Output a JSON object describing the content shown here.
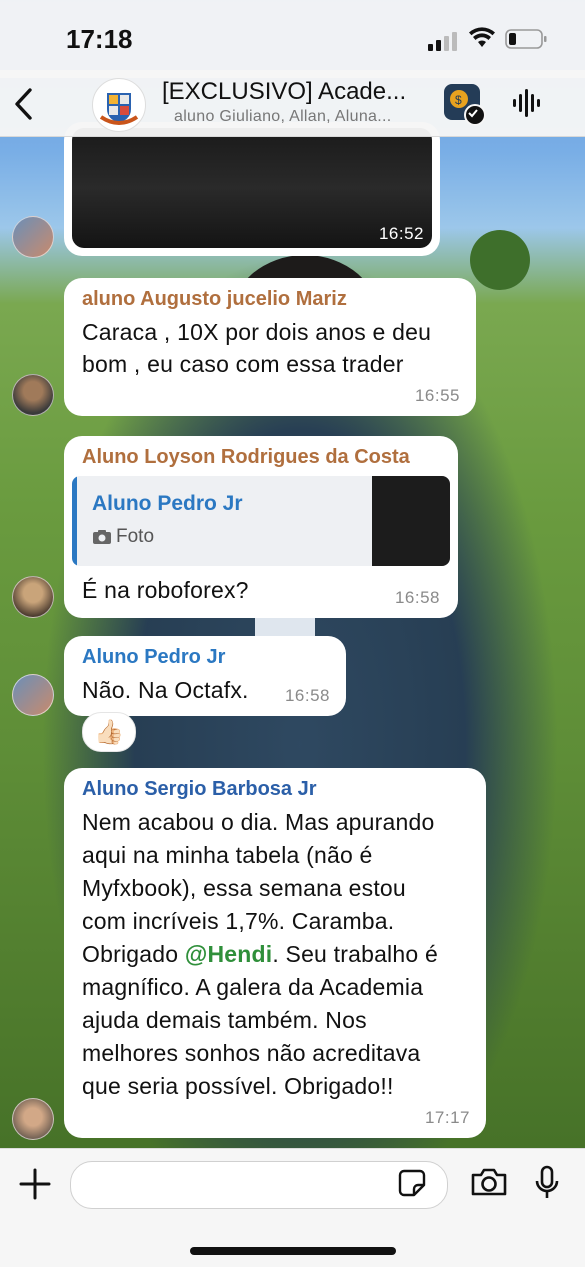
{
  "status_bar": {
    "time": "17:18"
  },
  "header": {
    "title": "[EXCLUSIVO] Acade...",
    "subtitle": "aluno Giuliano, Allan, Aluna...",
    "group_avatar_icon": "academy-crest-icon",
    "app_badge_icon": "copy-trade-icon"
  },
  "messages": [
    {
      "type": "video",
      "timestamp": "16:52"
    },
    {
      "type": "text",
      "sender": "aluno Augusto jucelio Mariz",
      "sender_color": "#b06f3e",
      "text_lines": [
        "Caraca , 10X por dois anos e deu",
        "bom , eu caso com essa trader"
      ],
      "timestamp": "16:55"
    },
    {
      "type": "reply",
      "sender": "Aluno Loyson Rodrigues da Costa",
      "sender_color": "#b06f3e",
      "quoted_sender": "Aluno Pedro Jr",
      "quoted_type": "Foto",
      "text": "É na roboforex?",
      "timestamp": "16:58"
    },
    {
      "type": "text",
      "sender": "Aluno Pedro Jr",
      "sender_color": "#2b78c2",
      "text": "Não. Na Octafx.",
      "timestamp": "16:58",
      "reaction": "👍🏻"
    },
    {
      "type": "text",
      "sender": "Aluno Sergio Barbosa Jr",
      "sender_color": "#2b5fa8",
      "lines": [
        "Nem acabou o dia. Mas apurando",
        "aqui na minha tabela (não é",
        "Myfxbook), essa semana estou",
        "com incríveis 1,7%. Caramba.",
        "Obrigado ",
        "@Hendi",
        ". Seu trabalho é",
        "magnífico. A galera da Academia",
        "ajuda demais também. Nos",
        "melhores sonhos não acreditava",
        "que seria possível. Obrigado!!"
      ],
      "timestamp": "17:17"
    }
  ],
  "input": {
    "placeholder": ""
  },
  "colors": {
    "mention": "#2f8f3a",
    "quote_bar": "#2b78c2"
  }
}
